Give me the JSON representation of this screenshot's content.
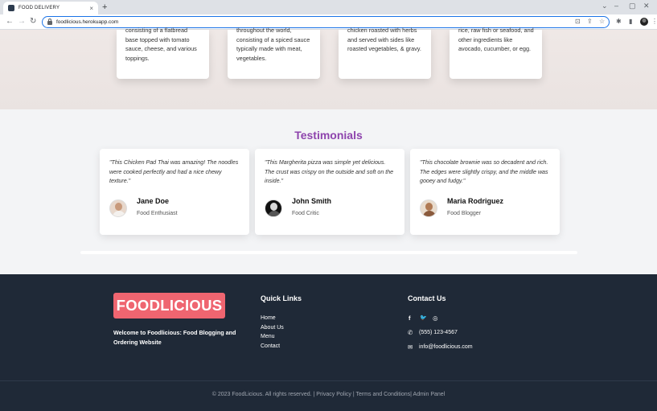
{
  "browser": {
    "tab_title": "FOOD DELIVERY",
    "tab_close": "×",
    "new_tab": "+",
    "url": "foodlicious.herokuapp.com",
    "nav": {
      "back": "←",
      "forward": "→",
      "reload": "↻"
    },
    "window_controls": {
      "chevron": "⌄",
      "minimize": "–",
      "maximize": "▢",
      "close": "✕"
    }
  },
  "cuisine_cards": [
    {
      "text": "consisting of a flatbread base topped with tomato sauce, cheese, and various toppings."
    },
    {
      "text": "throughout the world, consisting of a spiced sauce typically made with meat, vegetables."
    },
    {
      "text": "chicken roasted with herbs and served with sides like roasted vegetables, & gravy."
    },
    {
      "text": "rice, raw fish or seafood, and other ingredients like avocado, cucumber, or egg."
    }
  ],
  "testimonials": {
    "title": "Testimonials",
    "items": [
      {
        "quote": "\"This Chicken Pad Thai was amazing! The noodles were cooked perfectly and had a nice chewy texture.\"",
        "name": "Jane Doe",
        "role": "Food Enthusiast"
      },
      {
        "quote": "\"This Margherita pizza was simple yet delicious. The crust was crispy on the outside and soft on the inside.\"",
        "name": "John Smith",
        "role": "Food Critic"
      },
      {
        "quote": "\"This chocolate brownie was so decadent and rich. The edges were slightly crispy, and the middle was gooey and fudgy.\"",
        "name": "Maria Rodriguez",
        "role": "Food Blogger"
      }
    ]
  },
  "footer": {
    "logo": "FOODLICIOUS",
    "welcome": "Welcome to Foodlicious: Food Blogging and Ordering Website",
    "quick_links_title": "Quick Links",
    "quick_links": [
      "Home",
      "About Us",
      "Menu",
      "Contact"
    ],
    "contact_title": "Contact Us",
    "social": {
      "facebook": "f",
      "twitter": "🐦",
      "instagram": "◎"
    },
    "phone": "(555) 123-4567",
    "email": "info@foodlicious.com",
    "copyright": "© 2023 FoodLicious. All rights reserved. | Privacy Policy | Terms and Conditions| Admin Panel"
  },
  "colors": {
    "accent": "#8e44ad",
    "logo_bg": "#ef6570",
    "footer_bg": "#1f2937",
    "section_bg": "#f3f4f6"
  }
}
